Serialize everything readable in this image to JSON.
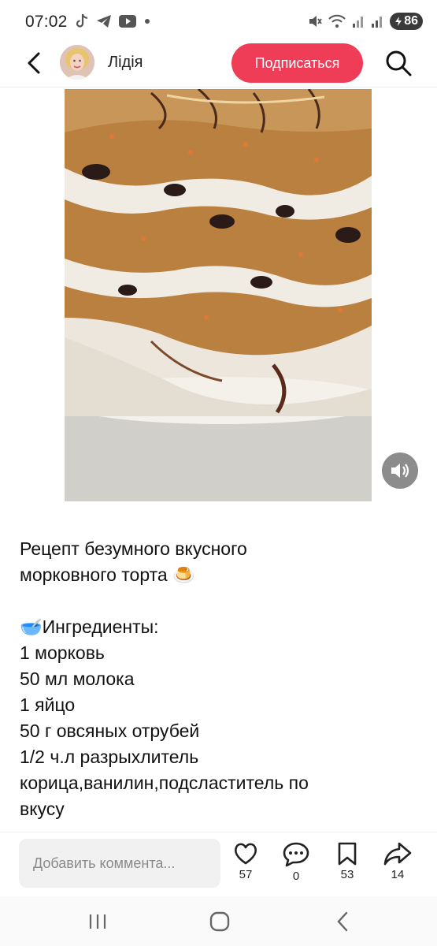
{
  "status_bar": {
    "time": "07:02",
    "battery": "86",
    "left_icons": [
      "tiktok-icon",
      "telegram-icon",
      "youtube-icon",
      "dot-icon"
    ],
    "right_icons": [
      "mute-icon",
      "wifi-icon",
      "signal-icon",
      "signal-icon"
    ]
  },
  "header": {
    "username": "Лідія",
    "subscribe_label": "Подписаться"
  },
  "post": {
    "title_line1": "Рецепт безумного вкусного",
    "title_line2": "морковного торта 🍮",
    "ingredients_heading": "🥣Ингредиенты:",
    "ingredients": [
      "1 морковь",
      "50 мл молока",
      "1 яйцо",
      "50 г овсяных отрубей",
      "1/2 ч.л разрыхлитель",
      "корица,ванилин,подсластитель по",
      "вкусу"
    ]
  },
  "actions": {
    "comment_placeholder": "Добавить коммента...",
    "likes": "57",
    "comments": "0",
    "saves": "53",
    "shares": "14"
  }
}
